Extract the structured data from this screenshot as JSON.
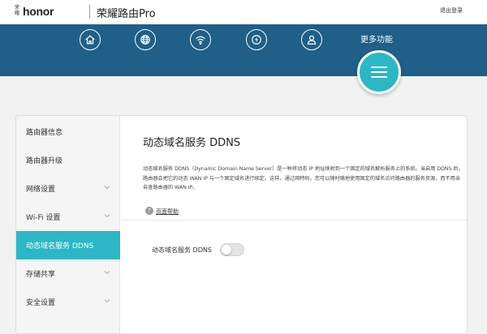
{
  "header": {
    "logo_mark": "荣耀",
    "logo_text": "honor",
    "product_name": "荣耀路由Pro",
    "logout_label": "退出登录"
  },
  "banner": {
    "nav_icons": [
      "home-icon",
      "globe-icon",
      "wifi-icon",
      "lightning-icon",
      "user-icon"
    ],
    "more_label": "更多功能",
    "more_icon": "menu-icon",
    "accent_color": "#2bb7c5",
    "banner_color": "#1f5f88"
  },
  "sidebar": {
    "items": [
      {
        "label": "路由器信息",
        "has_chevron": false,
        "active": false
      },
      {
        "label": "路由器升级",
        "has_chevron": false,
        "active": false
      },
      {
        "label": "网络设置",
        "has_chevron": true,
        "active": false
      },
      {
        "label": "Wi-Fi 设置",
        "has_chevron": true,
        "active": false
      },
      {
        "label": "动态域名服务 DDNS",
        "has_chevron": false,
        "active": true
      },
      {
        "label": "存储共享",
        "has_chevron": true,
        "active": false
      },
      {
        "label": "安全设置",
        "has_chevron": true,
        "active": false
      }
    ]
  },
  "content": {
    "title": "动态域名服务 DDNS",
    "description": "动态域名服务 DDNS（Dynamic Domain Name Server）是一种将动态 IP 地址映射到一个固定的域名解析服务上的系统。当启用 DDNS 后，路由器会把它的动态 WAN IP 与一个固定域名进行绑定。这样，通过固特码，您可以随时随地使用固定的域名访问路由器的服务资源，而不用亲自查路由器的 WAN IP。",
    "help_label": "页面帮助",
    "ddns_field_label": "动态域名服务 DDNS",
    "ddns_enabled": false
  }
}
